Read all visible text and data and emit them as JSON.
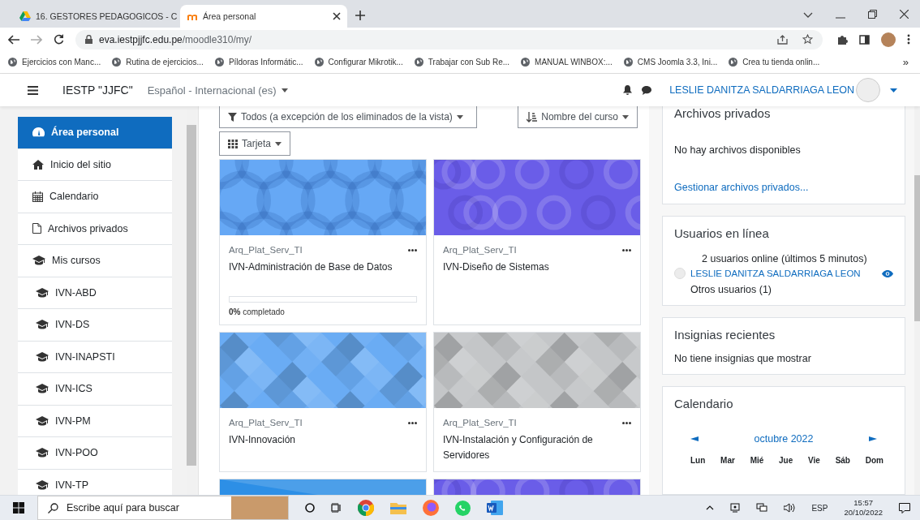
{
  "browser": {
    "tabs": [
      {
        "title": "16. GESTORES PEDAGOGICOS - C",
        "selected": false
      },
      {
        "title": "Área personal",
        "selected": true
      }
    ],
    "address": {
      "host": "eva.iestpjjfc.edu.pe",
      "path": "/moodle310/my/"
    },
    "bookmarks": [
      "Ejercicios con Manc...",
      "Rutina de ejercicios...",
      "Píldoras Informátic...",
      "Configurar Mikrotik...",
      "Trabajar con Sub Re...",
      "MANUAL WINBOX:...",
      "CMS Joomla 3.3, Ini...",
      "Crea tu tienda onlin..."
    ],
    "bookmarks_more": "»"
  },
  "navbar": {
    "site_name": "IESTP \"JJFC\"",
    "language": "Español - Internacional (es)",
    "user_name": "LESLIE DANITZA SALDARRIAGA LEON"
  },
  "sidebar": {
    "items": [
      {
        "label": "Área personal",
        "kind": "dashboard",
        "selected": true
      },
      {
        "label": "Inicio del sitio",
        "kind": "home",
        "selected": false
      },
      {
        "label": "Calendario",
        "kind": "calendar",
        "selected": false
      },
      {
        "label": "Archivos privados",
        "kind": "file",
        "selected": false
      },
      {
        "label": "Mis cursos",
        "kind": "courses",
        "selected": false,
        "children": [
          {
            "label": "IVN-ABD",
            "kind": "course",
            "selected": false
          },
          {
            "label": "IVN-DS",
            "kind": "course",
            "selected": false
          },
          {
            "label": "IVN-INAPSTI",
            "kind": "course",
            "selected": false
          },
          {
            "label": "IVN-ICS",
            "kind": "course",
            "selected": false
          },
          {
            "label": "IVN-PM",
            "kind": "course",
            "selected": false
          },
          {
            "label": "IVN-POO",
            "kind": "course",
            "selected": false
          },
          {
            "label": "IVN-TP",
            "kind": "course",
            "selected": false
          }
        ]
      }
    ]
  },
  "courses": {
    "filter": "Todos (a excepción de los eliminados de la vista)",
    "sort": "Nombre del curso",
    "view": "Tarjeta",
    "cards": [
      {
        "kind": "circles",
        "color": "#66a8f5",
        "category": "Arq_Plat_Serv_TI",
        "name": "IVN-Administración de Base de Datos",
        "level": 0,
        "progress_label": "**0%** completado"
      },
      {
        "kind": "rings",
        "color": "#6a5de8",
        "category": "Arq_Plat_Serv_TI",
        "name": "IVN-Diseño de Sistemas"
      },
      {
        "kind": "diamonds",
        "color": "#6aacf4",
        "category": "Arq_Plat_Serv_TI",
        "name": "IVN-Innovación"
      },
      {
        "kind": "diamonds",
        "color": "#c4c6c8",
        "category": "Arq_Plat_Serv_TI",
        "name": "IVN-Instalación y Configuración de Servidores"
      },
      {
        "kind": "stripes",
        "color": "#2d8fe6"
      },
      {
        "kind": "rings",
        "color": "#6a5de8"
      }
    ]
  },
  "private_files": {
    "title": "Archivos privados",
    "empty_text": "No hay archivos disponibles",
    "link": "Gestionar archivos privados..."
  },
  "online_users": {
    "title": "Usuarios en línea",
    "summary": "2 usuarios online (últimos 5 minutos)",
    "users": [
      {
        "name": "LESLIE DANITZA SALDARRIAGA LEON"
      }
    ],
    "others": "Otros usuarios (1)"
  },
  "badges": {
    "title": "Insignias recientes",
    "empty_text": "No tiene insignias que mostrar"
  },
  "calendar": {
    "title": "Calendario",
    "month": "octubre 2022",
    "weekdays": [
      "Lun",
      "Mar",
      "Mié",
      "Jue",
      "Vie",
      "Sáb",
      "Dom"
    ]
  },
  "taskbar": {
    "search_placeholder": "Escribe aquí para buscar",
    "language": "ESP",
    "time": "15:57",
    "date": "20/10/2022"
  }
}
